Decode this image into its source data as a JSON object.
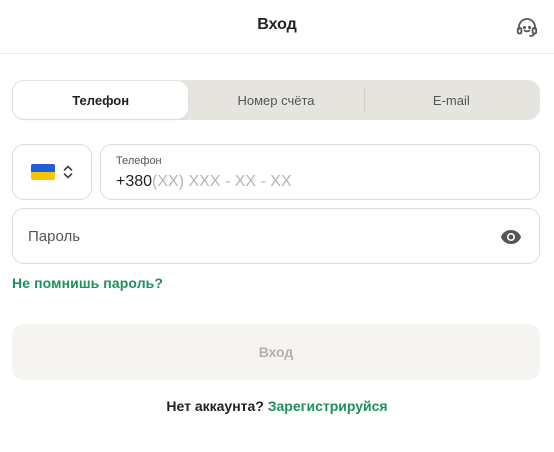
{
  "header": {
    "title": "Вход",
    "support_icon": "support-headset-icon"
  },
  "tabs": [
    {
      "label": "Телефон",
      "active": true
    },
    {
      "label": "Номер счёта",
      "active": false
    },
    {
      "label": "E-mail",
      "active": false
    }
  ],
  "phone": {
    "country_flag": "ukraine-flag-icon",
    "label": "Телефон",
    "prefix": "+380",
    "mask": "(XX) XXX - XX - XX"
  },
  "password": {
    "placeholder": "Пароль",
    "toggle_icon": "eye-icon"
  },
  "forgot_password": "Не помнишь пароль?",
  "login_button": "Вход",
  "register": {
    "question": "Нет аккаунта?",
    "link": "Зарегистрируйся"
  },
  "colors": {
    "accent_green": "#1f8f5f",
    "flag_blue": "#1f5fd6",
    "flag_yellow": "#f7c600",
    "tab_bg": "#e6e4df",
    "disabled_button_bg": "#f6f4f1",
    "disabled_button_text": "#b3b1ad"
  }
}
